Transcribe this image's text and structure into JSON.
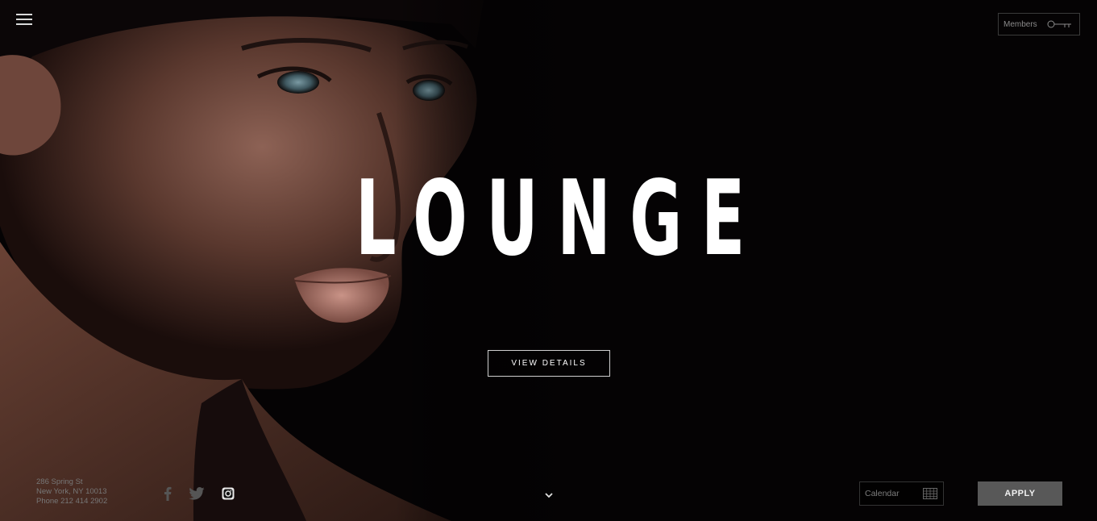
{
  "header": {
    "menu_icon": "hamburger-icon",
    "members_label": "Members",
    "members_icon": "key-icon"
  },
  "hero": {
    "title": "LOUNGE",
    "cta_label": "VIEW DETAILS",
    "image": "woman-portrait-photo"
  },
  "footer": {
    "address_lines": [
      "286 Spring St",
      "New York, NY 10013",
      "Phone 212 414 2902"
    ],
    "social": [
      {
        "name": "facebook",
        "icon": "facebook-icon"
      },
      {
        "name": "twitter",
        "icon": "twitter-icon"
      },
      {
        "name": "instagram",
        "icon": "instagram-icon"
      }
    ],
    "scroll_icon": "chevron-down-icon",
    "calendar_placeholder": "Calendar",
    "calendar_icon": "calendar-grid-icon",
    "apply_label": "APPLY"
  },
  "colors": {
    "background": "#050304",
    "title": "#ffffff",
    "apply_button": "#585858",
    "muted_text": "#777777"
  }
}
